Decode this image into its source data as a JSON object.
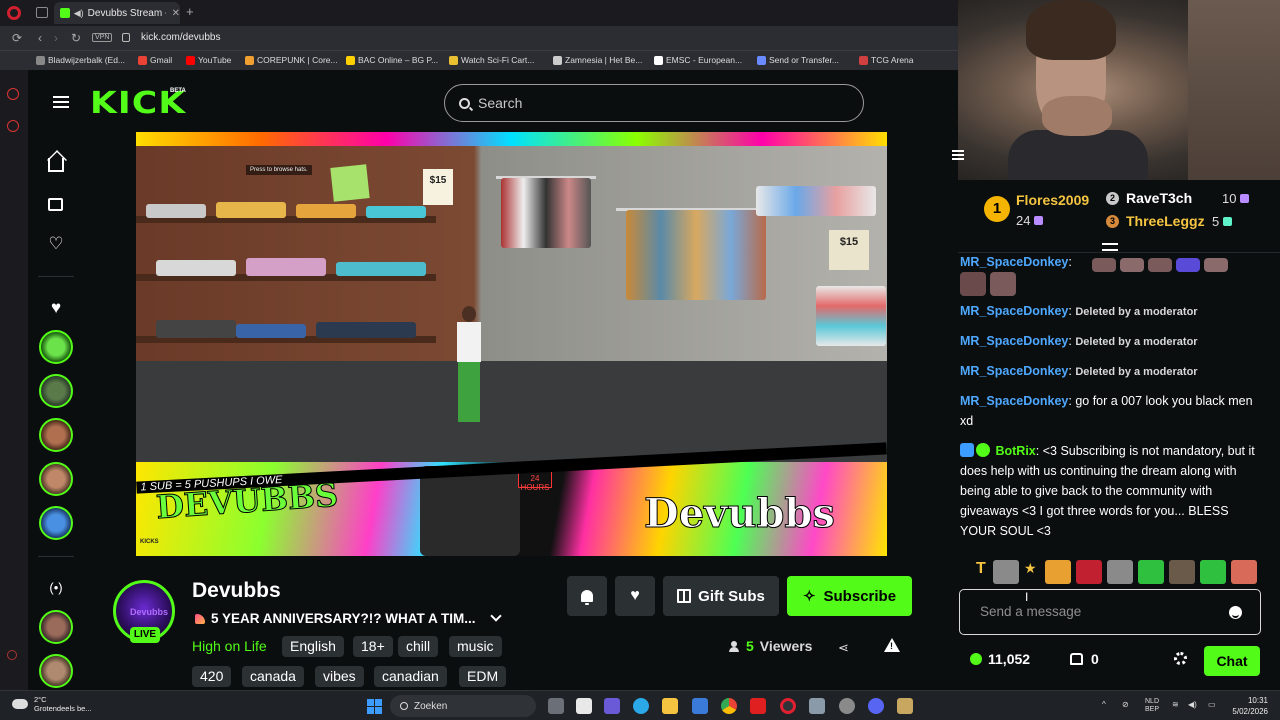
{
  "browser": {
    "tab_title": "Devubbs Stream - Wat",
    "url": "kick.com/devubbs",
    "vpn_label": "VPN",
    "bookmarks": [
      {
        "label": "Bladwijzerbalk (Ed...",
        "color": "#888888"
      },
      {
        "label": "Gmail",
        "color": "#ea4335"
      },
      {
        "label": "YouTube",
        "color": "#ff0000"
      },
      {
        "label": "COREPUNK | Core...",
        "color": "#f0a030"
      },
      {
        "label": "BAC Online – BG P...",
        "color": "#ffd000"
      },
      {
        "label": "Watch Sci-Fi Cart...",
        "color": "#e8c030"
      },
      {
        "label": "Zamnesia | Het Be...",
        "color": "#cccccc"
      },
      {
        "label": "EMSC - European...",
        "color": "#ffffff"
      },
      {
        "label": "Send or Transfer...",
        "color": "#6a8aff"
      },
      {
        "label": "TCG Arena",
        "color": "#d04040"
      }
    ]
  },
  "header": {
    "logo": "KICK",
    "beta": "BETA",
    "search_placeholder": "Search"
  },
  "video": {
    "press_hint": "Press   to browse hats.",
    "sign_price": "$15",
    "sign_price2": "$15",
    "banner_left": "DEVUBBS",
    "banner_right": "Devubbs",
    "banner_tag": "1 SUB = 5 PUSHUPS I OWE",
    "banner_open": "OPEN 24 HOURS",
    "banner_kicks": "KICKS"
  },
  "stream": {
    "channel_name": "Devubbs",
    "avatar_text": "Devubbs",
    "live_label": "LIVE",
    "title": "5 YEAR ANNIVERSARY?!? WHAT A TIM...",
    "category": "High on Life",
    "tags": [
      "English",
      "18+",
      "chill",
      "music",
      "420",
      "canada",
      "vibes",
      "canadian",
      "EDM"
    ],
    "gift_label": "Gift Subs",
    "subscribe_label": "Subscribe",
    "viewers_count": "5",
    "viewers_label": "Viewers"
  },
  "chat": {
    "leaderboard": [
      {
        "rank": "1",
        "name": "Flores2009",
        "value": "24",
        "color": "#f5b400",
        "name_color": "#f5c542"
      },
      {
        "rank": "2",
        "name": "RaveT3ch",
        "value": "10",
        "color": "#c9c9c9",
        "name_color": "#ffffff"
      },
      {
        "rank": "3",
        "name": "ThreeLeggz",
        "value": "5",
        "color": "#d88a3c",
        "name_color": "#f5c542"
      }
    ],
    "messages": [
      {
        "user": "MR_SpaceDonkey",
        "text": "",
        "deleted": false,
        "emotes": true
      },
      {
        "user": "MR_SpaceDonkey",
        "text": "Deleted by a moderator",
        "deleted": true
      },
      {
        "user": "MR_SpaceDonkey",
        "text": "Deleted by a moderator",
        "deleted": true
      },
      {
        "user": "MR_SpaceDonkey",
        "text": "Deleted by a moderator",
        "deleted": true
      },
      {
        "user": "MR_SpaceDonkey",
        "text": "go for a 007 look you black men xd",
        "deleted": false
      },
      {
        "user": "BotRix",
        "text": "<3 Subscribing is not mandatory, but it does help with us continuing the dream along with being able to give back to the community with giveaways <3 I got three words for you... BLESS YOUR SOUL <3",
        "deleted": false
      }
    ],
    "input_placeholder": "Send a message",
    "points": "11,052",
    "chest": "0",
    "chat_button": "Chat"
  },
  "taskbar": {
    "weather_temp": "2°C",
    "weather_desc": "Grotendeels be...",
    "search_label": "Zoeken",
    "lang1": "NLD",
    "lang2": "BEP",
    "time": "10:31",
    "date": "5/02/2026"
  },
  "colors": {
    "kick_green": "#53fc18",
    "background": "#0b0e0f",
    "username_blue": "#4ea8ff"
  }
}
